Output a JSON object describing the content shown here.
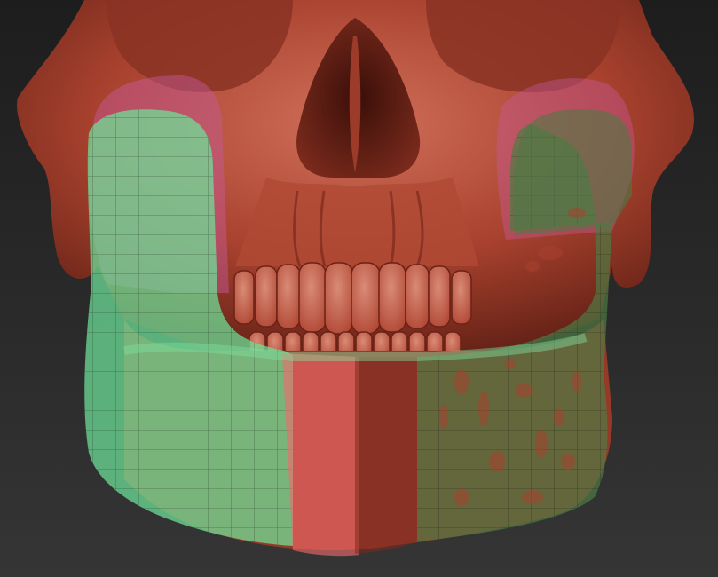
{
  "viewport": {
    "background_top": "#1d1d1d",
    "background_bottom": "#353535"
  },
  "model": {
    "subject": "skull",
    "skull_color": "#a8412e",
    "skull_shadow": "#5e1f14",
    "skull_highlight": "#d0705a",
    "teeth_color": "#b24a37",
    "teeth_highlight": "#d98b76"
  },
  "overlays": {
    "mandible_left_color": "#6ee39a",
    "mandible_right_color": "#4f7a45",
    "chin_strip_color": "#f06a6a",
    "center_strip_color": "#7d2a20",
    "coronoid_color": "#c85aa0"
  }
}
